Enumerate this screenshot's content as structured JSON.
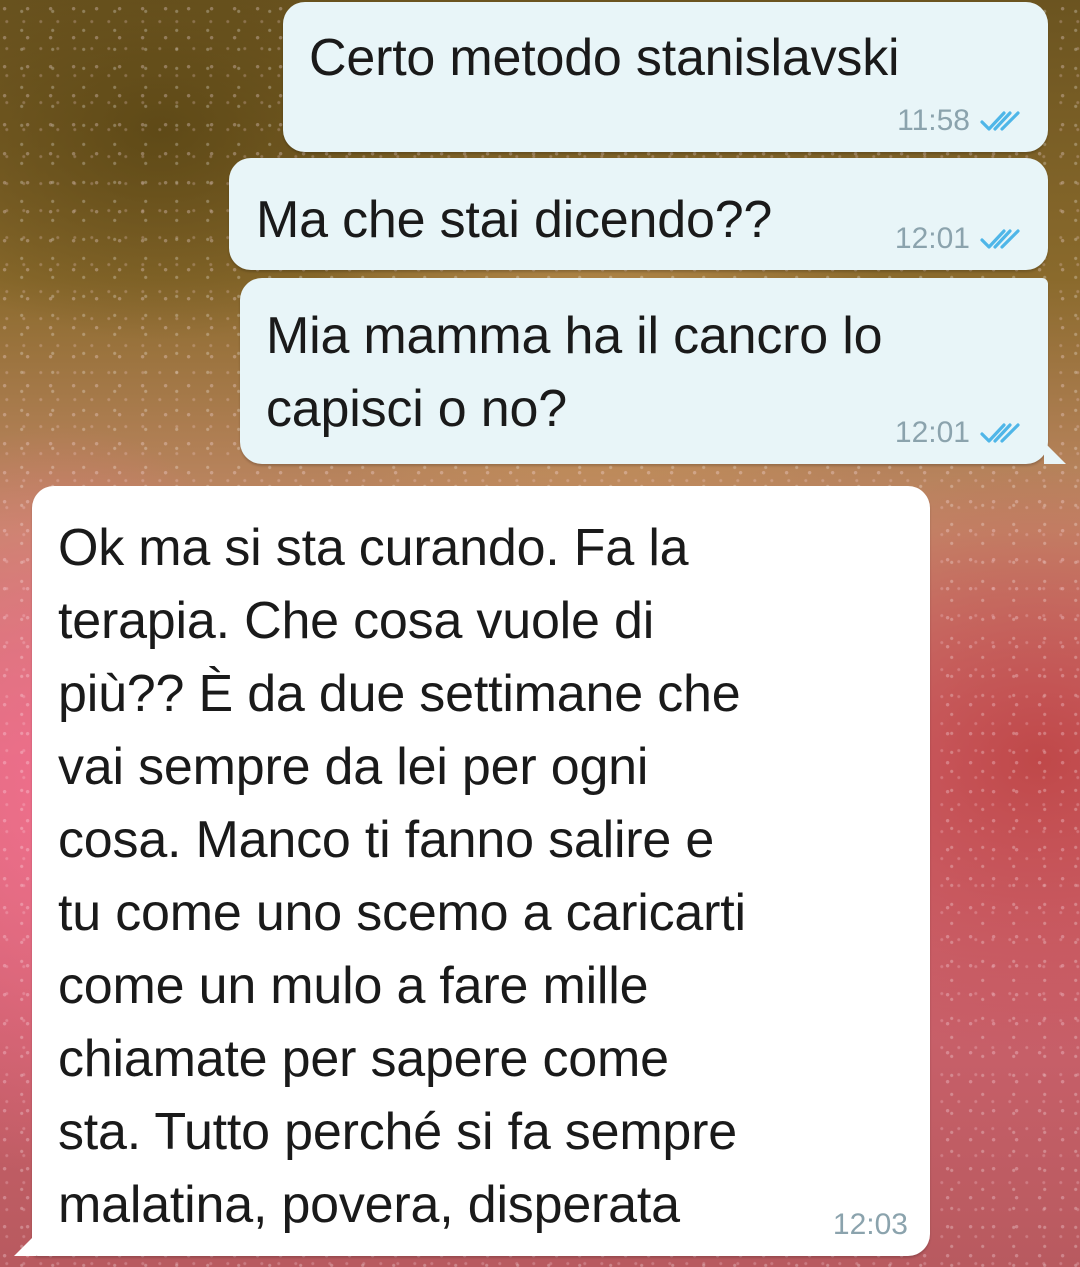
{
  "theme": {
    "outgoing_bubble": "#e8f5f8",
    "incoming_bubble": "#ffffff",
    "read_ticks": "#4fb6e8",
    "timestamp_color": "#8ba3ad"
  },
  "messages": [
    {
      "direction": "outgoing",
      "text": "Certo metodo stanislavski",
      "time": "11:58",
      "status_icon": "double-check-read-icon"
    },
    {
      "direction": "outgoing",
      "text": "Ma che stai dicendo??",
      "time": "12:01",
      "status_icon": "double-check-read-icon"
    },
    {
      "direction": "outgoing",
      "text": "Mia mamma ha il cancro lo\ncapisci o no?",
      "time": "12:01",
      "status_icon": "double-check-read-icon"
    },
    {
      "direction": "incoming",
      "text": "Ok ma si sta curando. Fa la\nterapia. Che cosa vuole di\npiù?? È da due settimane che\nvai sempre da lei per ogni\ncosa. Manco ti fanno salire e\ntu come uno scemo a caricarti\ncome un mulo a fare mille\nchiamate per sapere come\nsta. Tutto perché si fa sempre\nmalatina, povera, disperata",
      "time": "12:03"
    }
  ]
}
